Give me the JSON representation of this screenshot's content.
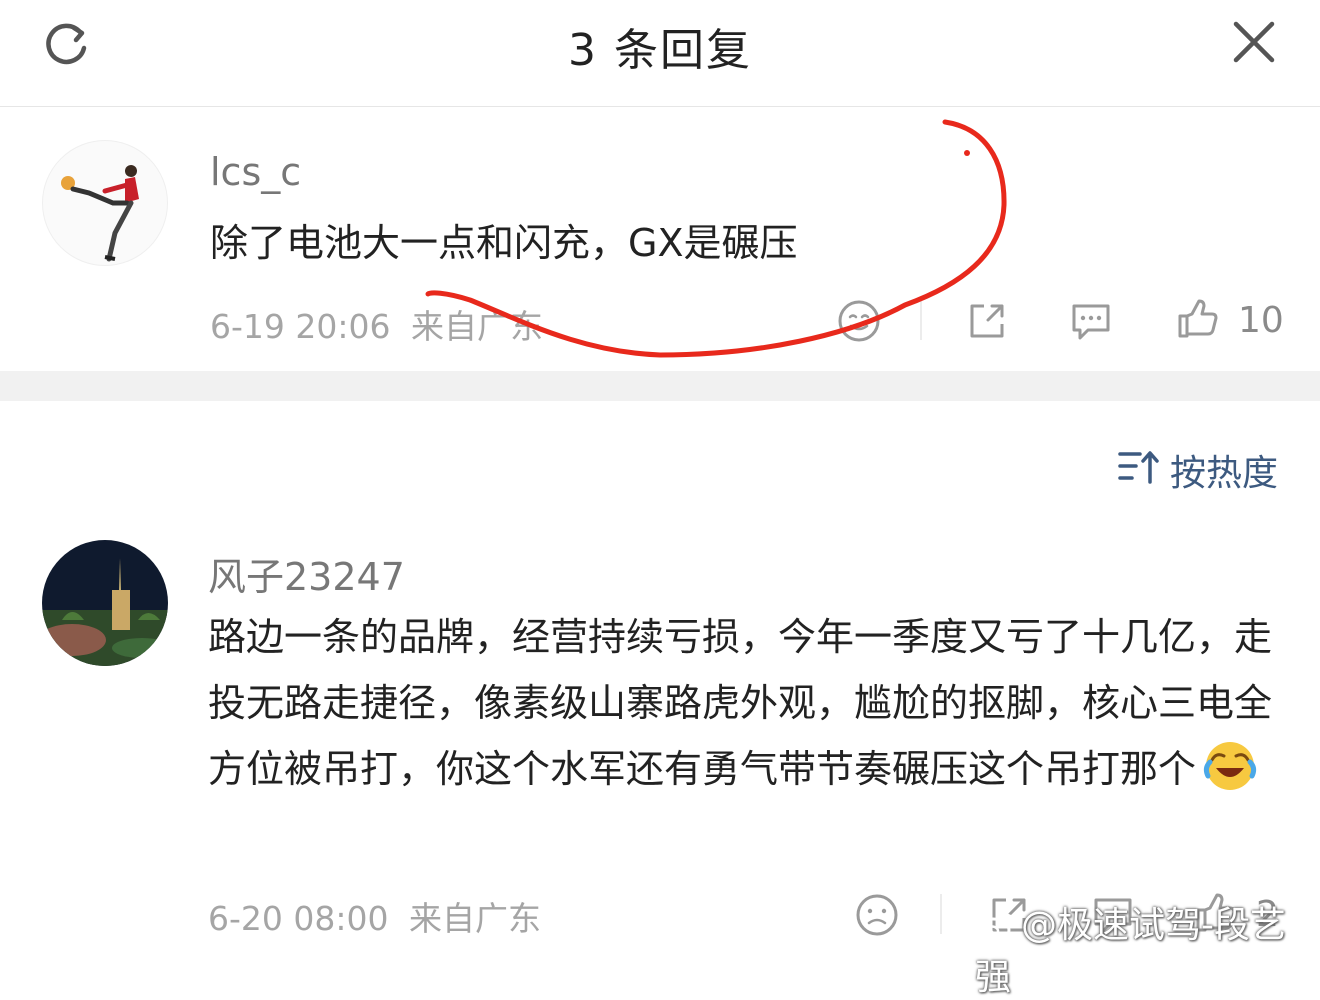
{
  "header": {
    "title": "3 条回复",
    "refresh_icon": "refresh-icon",
    "close_icon": "close-icon"
  },
  "root_comment": {
    "username": "lcs_c",
    "content": "除了电池大一点和闪充，GX是碾压",
    "timestamp": "6-19 20:06",
    "location": "来自广东",
    "like_count": "10"
  },
  "sort": {
    "label": "按热度",
    "icon": "sort-icon"
  },
  "replies": [
    {
      "username": "风子23247",
      "content": "路边一条的品牌，经营持续亏损，今年一季度又亏了十几亿，走投无路走捷径，像素级山寨路虎外观，尴尬的抠脚，核心三电全方位被吊打，你这个水军还有勇气带节奏碾压这个吊打那个",
      "timestamp": "6-20 08:00",
      "location": "来自广东",
      "like_count": "2"
    }
  ],
  "watermark": "@极速试驾-段艺强",
  "colors": {
    "annotation_red": "#e8291c",
    "sort_blue": "#3d5a80",
    "meta_gray": "#a5a5a5"
  }
}
